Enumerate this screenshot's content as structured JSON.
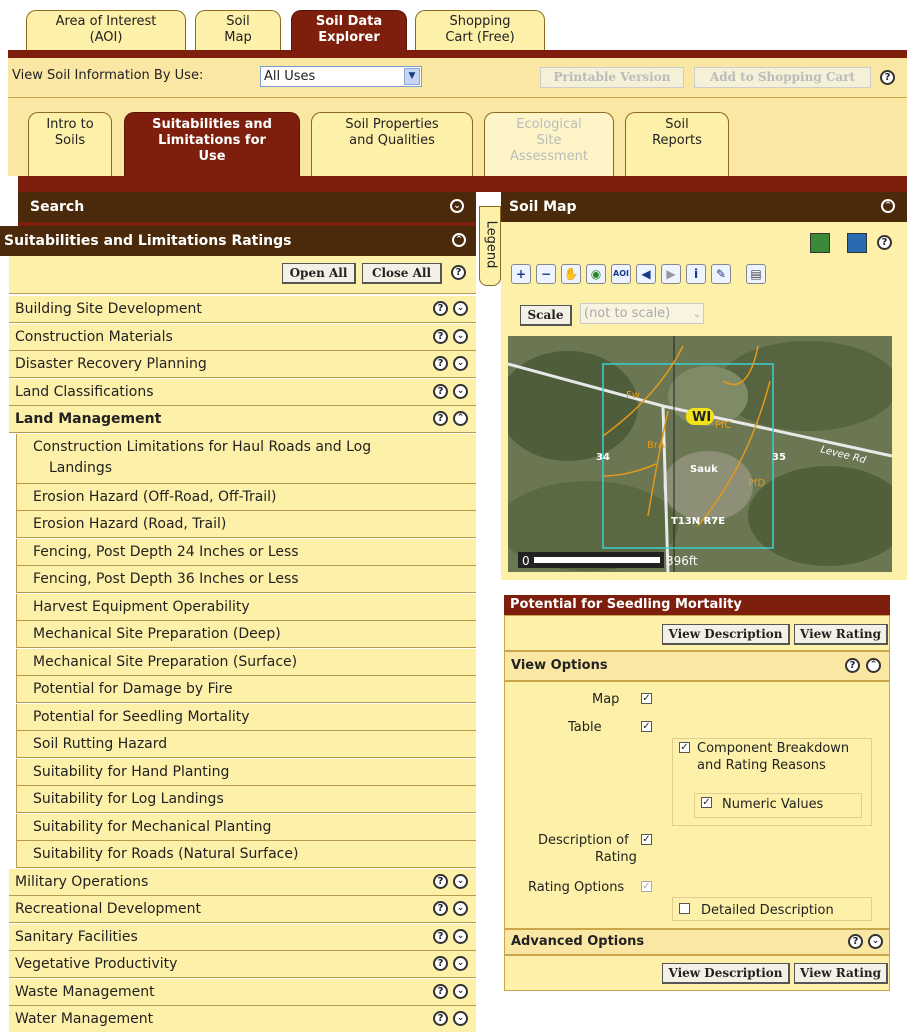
{
  "top_tabs": [
    {
      "l1": "Area of Interest",
      "l2": "(AOI)"
    },
    {
      "l1": "Soil",
      "l2": "Map"
    },
    {
      "l1": "Soil Data",
      "l2": "Explorer"
    },
    {
      "l1": "Shopping",
      "l2": "Cart (Free)"
    }
  ],
  "view_bar": {
    "label": "View Soil Information By Use:",
    "select_value": "All Uses",
    "printable": "Printable Version",
    "add_cart": "Add to Shopping Cart"
  },
  "sub_tabs": [
    {
      "l1": "Intro to",
      "l2": "Soils",
      "l3": ""
    },
    {
      "l1": "Suitabilities and",
      "l2": "Limitations for",
      "l3": "Use"
    },
    {
      "l1": "Soil Properties",
      "l2": "and Qualities",
      "l3": ""
    },
    {
      "l1": "Ecological",
      "l2": "Site",
      "l3": "Assessment"
    },
    {
      "l1": "Soil",
      "l2": "Reports",
      "l3": ""
    }
  ],
  "search": {
    "title": "Search"
  },
  "ratings": {
    "title": "Suitabilities and Limitations Ratings",
    "open_all": "Open All",
    "close_all": "Close All"
  },
  "categories_before": [
    "Building Site Development",
    "Construction Materials",
    "Disaster Recovery Planning",
    "Land Classifications"
  ],
  "land_management": {
    "title": "Land Management",
    "items": [
      "Construction Limitations for Haul Roads and Log",
      "Landings",
      "Erosion Hazard (Off-Road, Off-Trail)",
      "Erosion Hazard (Road, Trail)",
      "Fencing, Post Depth 24 Inches or Less",
      "Fencing, Post Depth 36 Inches or Less",
      "Harvest Equipment Operability",
      "Mechanical Site Preparation (Deep)",
      "Mechanical Site Preparation (Surface)",
      "Potential for Damage by Fire",
      "Potential for Seedling Mortality",
      "Soil Rutting Hazard",
      "Suitability for Hand Planting",
      "Suitability for Log Landings",
      "Suitability for Mechanical Planting",
      "Suitability for Roads (Natural Surface)"
    ]
  },
  "categories_after": [
    "Military Operations",
    "Recreational Development",
    "Sanitary Facilities",
    "Vegetative Productivity",
    "Waste Management",
    "Water Management"
  ],
  "legend_tab": "Legend",
  "soil_map": {
    "title": "Soil Map",
    "scale_btn": "Scale",
    "scale_value": "(not to scale)",
    "scalebar_start": "0",
    "scalebar_end": "396ft",
    "labels": {
      "fw": "Fw",
      "wi": "WI",
      "pfc": "PfC",
      "bra": "BrA",
      "s34": "34",
      "s35": "35",
      "sauk": "Sauk",
      "pfd": "PfD",
      "twp": "T13N R7E",
      "road": "Levee Rd"
    }
  },
  "panel": {
    "title": "Potential for Seedling Mortality",
    "view_description": "View Description",
    "view_rating": "View Rating",
    "view_options": "View Options",
    "map": "Map",
    "table": "Table",
    "component": "Component Breakdown",
    "component2": "and Rating Reasons",
    "numeric": "Numeric Values",
    "description_of": "Description of",
    "rating": "Rating",
    "rating_options": "Rating Options",
    "detailed": "Detailed Description",
    "advanced": "Advanced Options"
  },
  "colors": {
    "maroon": "#7d1f0c",
    "tab_yellow": "#fdf0a8",
    "header_brown": "#4a2a0a"
  }
}
